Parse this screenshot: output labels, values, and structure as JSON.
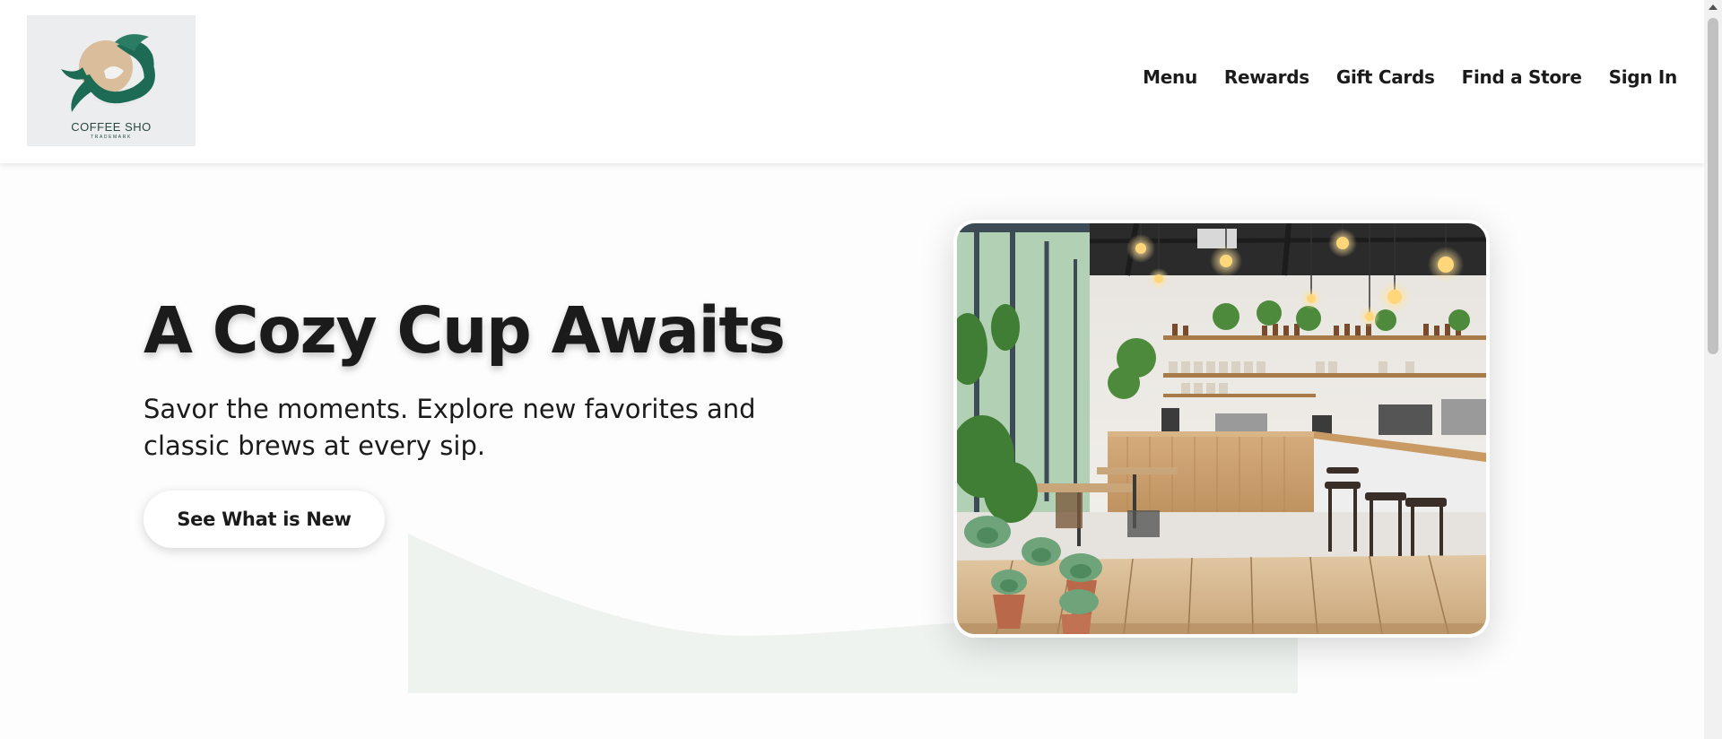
{
  "brand": {
    "logo_text": "COFFEE SHO",
    "logo_subtext": "TRADEMARK",
    "colors": {
      "primary": "#1e6b55",
      "accent": "#d7b48b"
    }
  },
  "nav": {
    "items": [
      {
        "label": "Menu"
      },
      {
        "label": "Rewards"
      },
      {
        "label": "Gift Cards"
      },
      {
        "label": "Find a Store"
      },
      {
        "label": "Sign In"
      }
    ]
  },
  "hero": {
    "title": "A Cozy Cup Awaits",
    "subtitle": "Savor the moments. Explore new favorites and classic brews at every sip.",
    "cta_label": "See What is New",
    "image_alt": "Bright coffee shop interior with wooden table and plants"
  },
  "colors": {
    "text": "#1b1b1b",
    "wave": "#eef3f0",
    "background": "#fdfdfd"
  }
}
